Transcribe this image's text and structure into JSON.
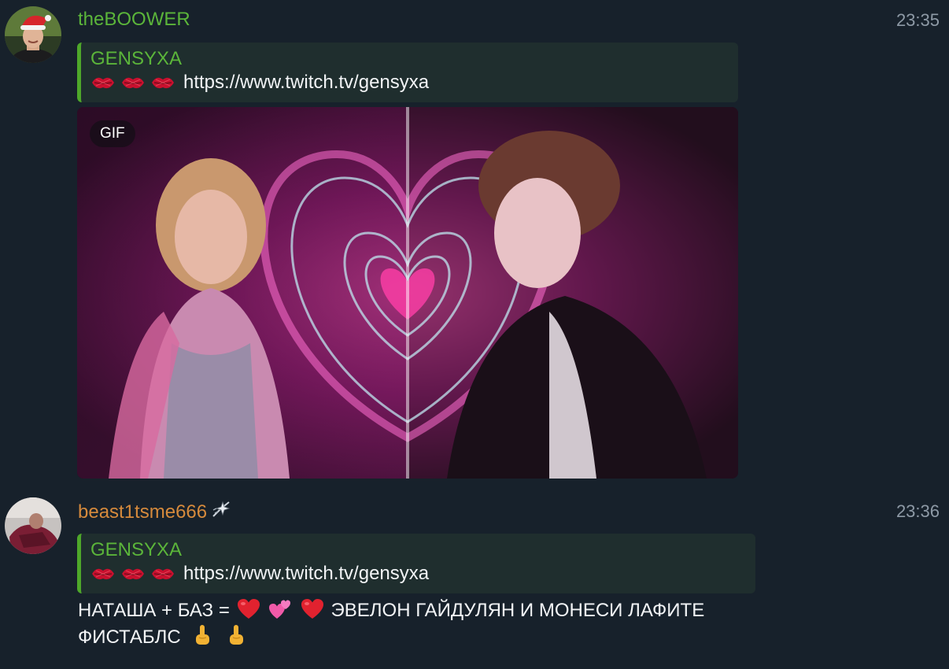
{
  "messages": [
    {
      "author": "theBOOWER",
      "author_color": "#5bb53a",
      "time": "23:35",
      "avatar_icon": "user-avatar-santa-hat-icon",
      "reply": {
        "author": "GENSYXA",
        "emojis": [
          "kiss-mark-icon",
          "kiss-mark-icon",
          "kiss-mark-icon"
        ],
        "link": "https://www.twitch.tv/gensyxa"
      },
      "media": {
        "badge": "GIF"
      }
    },
    {
      "author": "beast1tsme666",
      "author_color": "#d68a3c",
      "time": "23:36",
      "avatar_icon": "user-avatar-icon",
      "author_badge_icon": "sparkle-star-icon",
      "reply": {
        "author": "GENSYXA",
        "emojis": [
          "kiss-mark-icon",
          "kiss-mark-icon",
          "kiss-mark-icon"
        ],
        "link": "https://www.twitch.tv/gensyxa"
      },
      "text": {
        "part1": "НАТАША + БАЗ =",
        "emoji_after_part1": [
          "red-heart-icon",
          "two-hearts-icon",
          "red-heart-icon"
        ],
        "part2": "ЭВЕЛОН ГАЙДУЛЯН И МОНЕСИ ЛАФИТЕ",
        "part3": "ФИСТАБЛС",
        "emoji_after_part3": [
          "middle-finger-icon",
          "middle-finger-icon"
        ]
      }
    }
  ],
  "colors": {
    "background": "#17212b",
    "quote_background": "#1f2e2e",
    "quote_bar": "#4ea82a",
    "timestamp": "#8e9aa6"
  }
}
